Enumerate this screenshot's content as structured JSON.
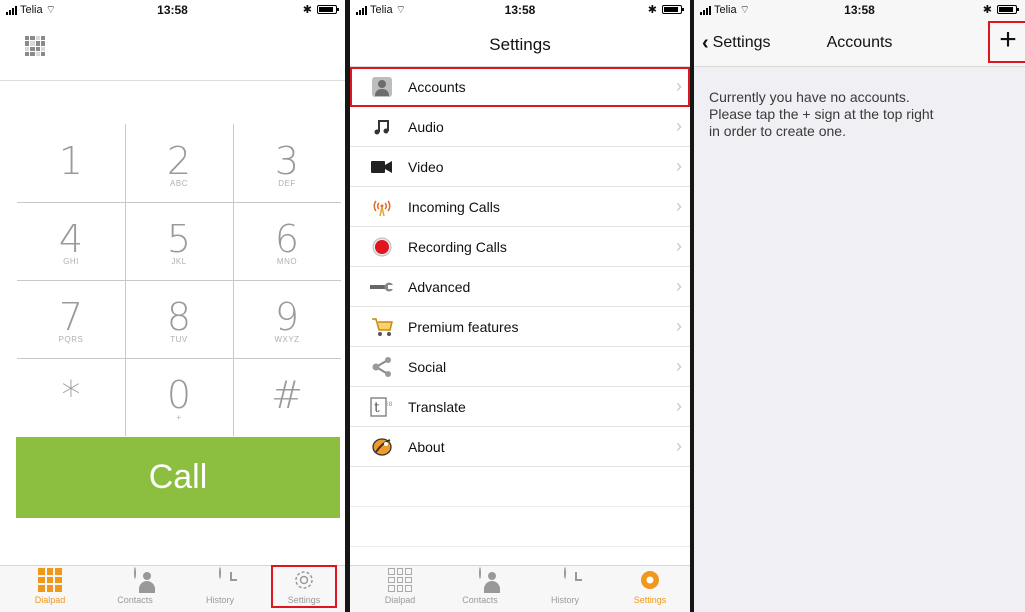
{
  "status_bar": {
    "carrier": "Telia",
    "time": "13:58"
  },
  "dialpad": {
    "keys": [
      {
        "digit": "1",
        "letters": ""
      },
      {
        "digit": "2",
        "letters": "ABC"
      },
      {
        "digit": "3",
        "letters": "DEF"
      },
      {
        "digit": "4",
        "letters": "GHI"
      },
      {
        "digit": "5",
        "letters": "JKL"
      },
      {
        "digit": "6",
        "letters": "MNO"
      },
      {
        "digit": "7",
        "letters": "PQRS"
      },
      {
        "digit": "8",
        "letters": "TUV"
      },
      {
        "digit": "9",
        "letters": "WXYZ"
      },
      {
        "digit": "*",
        "letters": ""
      },
      {
        "digit": "0",
        "letters": "+"
      },
      {
        "digit": "#",
        "letters": ""
      }
    ],
    "call_label": "Call"
  },
  "tabbar": {
    "dialpad": "Dialpad",
    "contacts": "Contacts",
    "history": "History",
    "settings": "Settings"
  },
  "settings": {
    "title": "Settings",
    "items": [
      {
        "label": "Accounts",
        "icon": "accounts-icon"
      },
      {
        "label": "Audio",
        "icon": "music-note-icon"
      },
      {
        "label": "Video",
        "icon": "video-camera-icon"
      },
      {
        "label": "Incoming Calls",
        "icon": "antenna-icon"
      },
      {
        "label": "Recording Calls",
        "icon": "record-icon"
      },
      {
        "label": "Advanced",
        "icon": "wrench-icon"
      },
      {
        "label": "Premium features",
        "icon": "cart-icon"
      },
      {
        "label": "Social",
        "icon": "share-icon"
      },
      {
        "label": "Translate",
        "icon": "translate-icon"
      },
      {
        "label": "About",
        "icon": "about-icon"
      }
    ]
  },
  "accounts": {
    "back_label": "Settings",
    "title": "Accounts",
    "add_label": "+",
    "message": "Currently you have no accounts.\nPlease tap the + sign at the top right\nin order to create one."
  },
  "colors": {
    "accent_orange": "#f0981c",
    "call_green": "#8cbe3f",
    "highlight_red": "#e0161f"
  }
}
